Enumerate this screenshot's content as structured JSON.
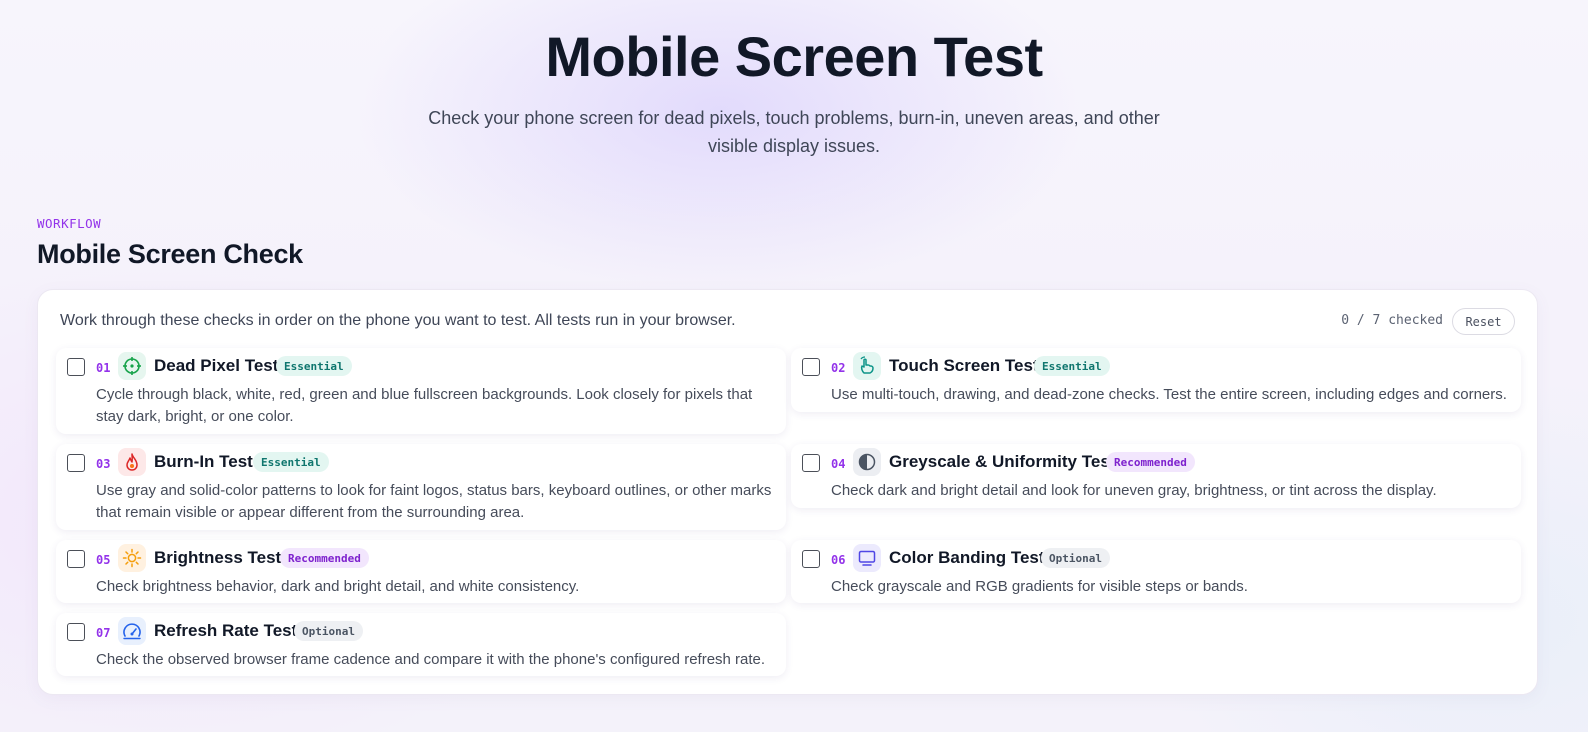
{
  "hero": {
    "title": "Mobile Screen Test",
    "subtitle": "Check your phone screen for dead pixels, touch problems, burn-in, uneven areas, and other visible display issues."
  },
  "section": {
    "eyebrow": "WORKFLOW",
    "title": "Mobile Screen Check",
    "intro": "Work through these checks in order on the phone you want to test. All tests run in your browser.",
    "progress": "0 / 7 checked",
    "reset_label": "Reset"
  },
  "colors": {
    "accent": "#9333ea",
    "essential": "#0f766e",
    "recommended": "#7e22ce",
    "optional": "#4b5563"
  },
  "tests": [
    {
      "num": "01",
      "title": "Dead Pixel Test",
      "badge": "Essential",
      "icon": "crosshair-icon",
      "checked": false,
      "desc": "Cycle through black, white, red, green and blue fullscreen backgrounds. Look closely for pixels that stay dark, bright, or one color."
    },
    {
      "num": "02",
      "title": "Touch Screen Test",
      "badge": "Essential",
      "icon": "touch-hand-icon",
      "checked": false,
      "desc": "Use multi-touch, drawing, and dead-zone checks. Test the entire screen, including edges and corners."
    },
    {
      "num": "03",
      "title": "Burn-In Test",
      "badge": "Essential",
      "icon": "flame-icon",
      "checked": false,
      "desc": "Use gray and solid-color patterns to look for faint logos, status bars, keyboard outlines, or other marks that remain visible or appear different from the surrounding area."
    },
    {
      "num": "04",
      "title": "Greyscale & Uniformity Test",
      "badge": "Recommended",
      "icon": "half-circle-icon",
      "checked": false,
      "desc": "Check dark and bright detail and look for uneven gray, brightness, or tint across the display."
    },
    {
      "num": "05",
      "title": "Brightness Test",
      "badge": "Recommended",
      "icon": "sun-icon",
      "checked": false,
      "desc": "Check brightness behavior, dark and bright detail, and white consistency."
    },
    {
      "num": "06",
      "title": "Color Banding Test",
      "badge": "Optional",
      "icon": "monitor-icon",
      "checked": false,
      "desc": "Check grayscale and RGB gradients for visible steps or bands."
    },
    {
      "num": "07",
      "title": "Refresh Rate Test",
      "badge": "Optional",
      "icon": "gauge-icon",
      "checked": false,
      "desc": "Check the observed browser frame cadence and compare it with the phone's configured refresh rate."
    }
  ]
}
